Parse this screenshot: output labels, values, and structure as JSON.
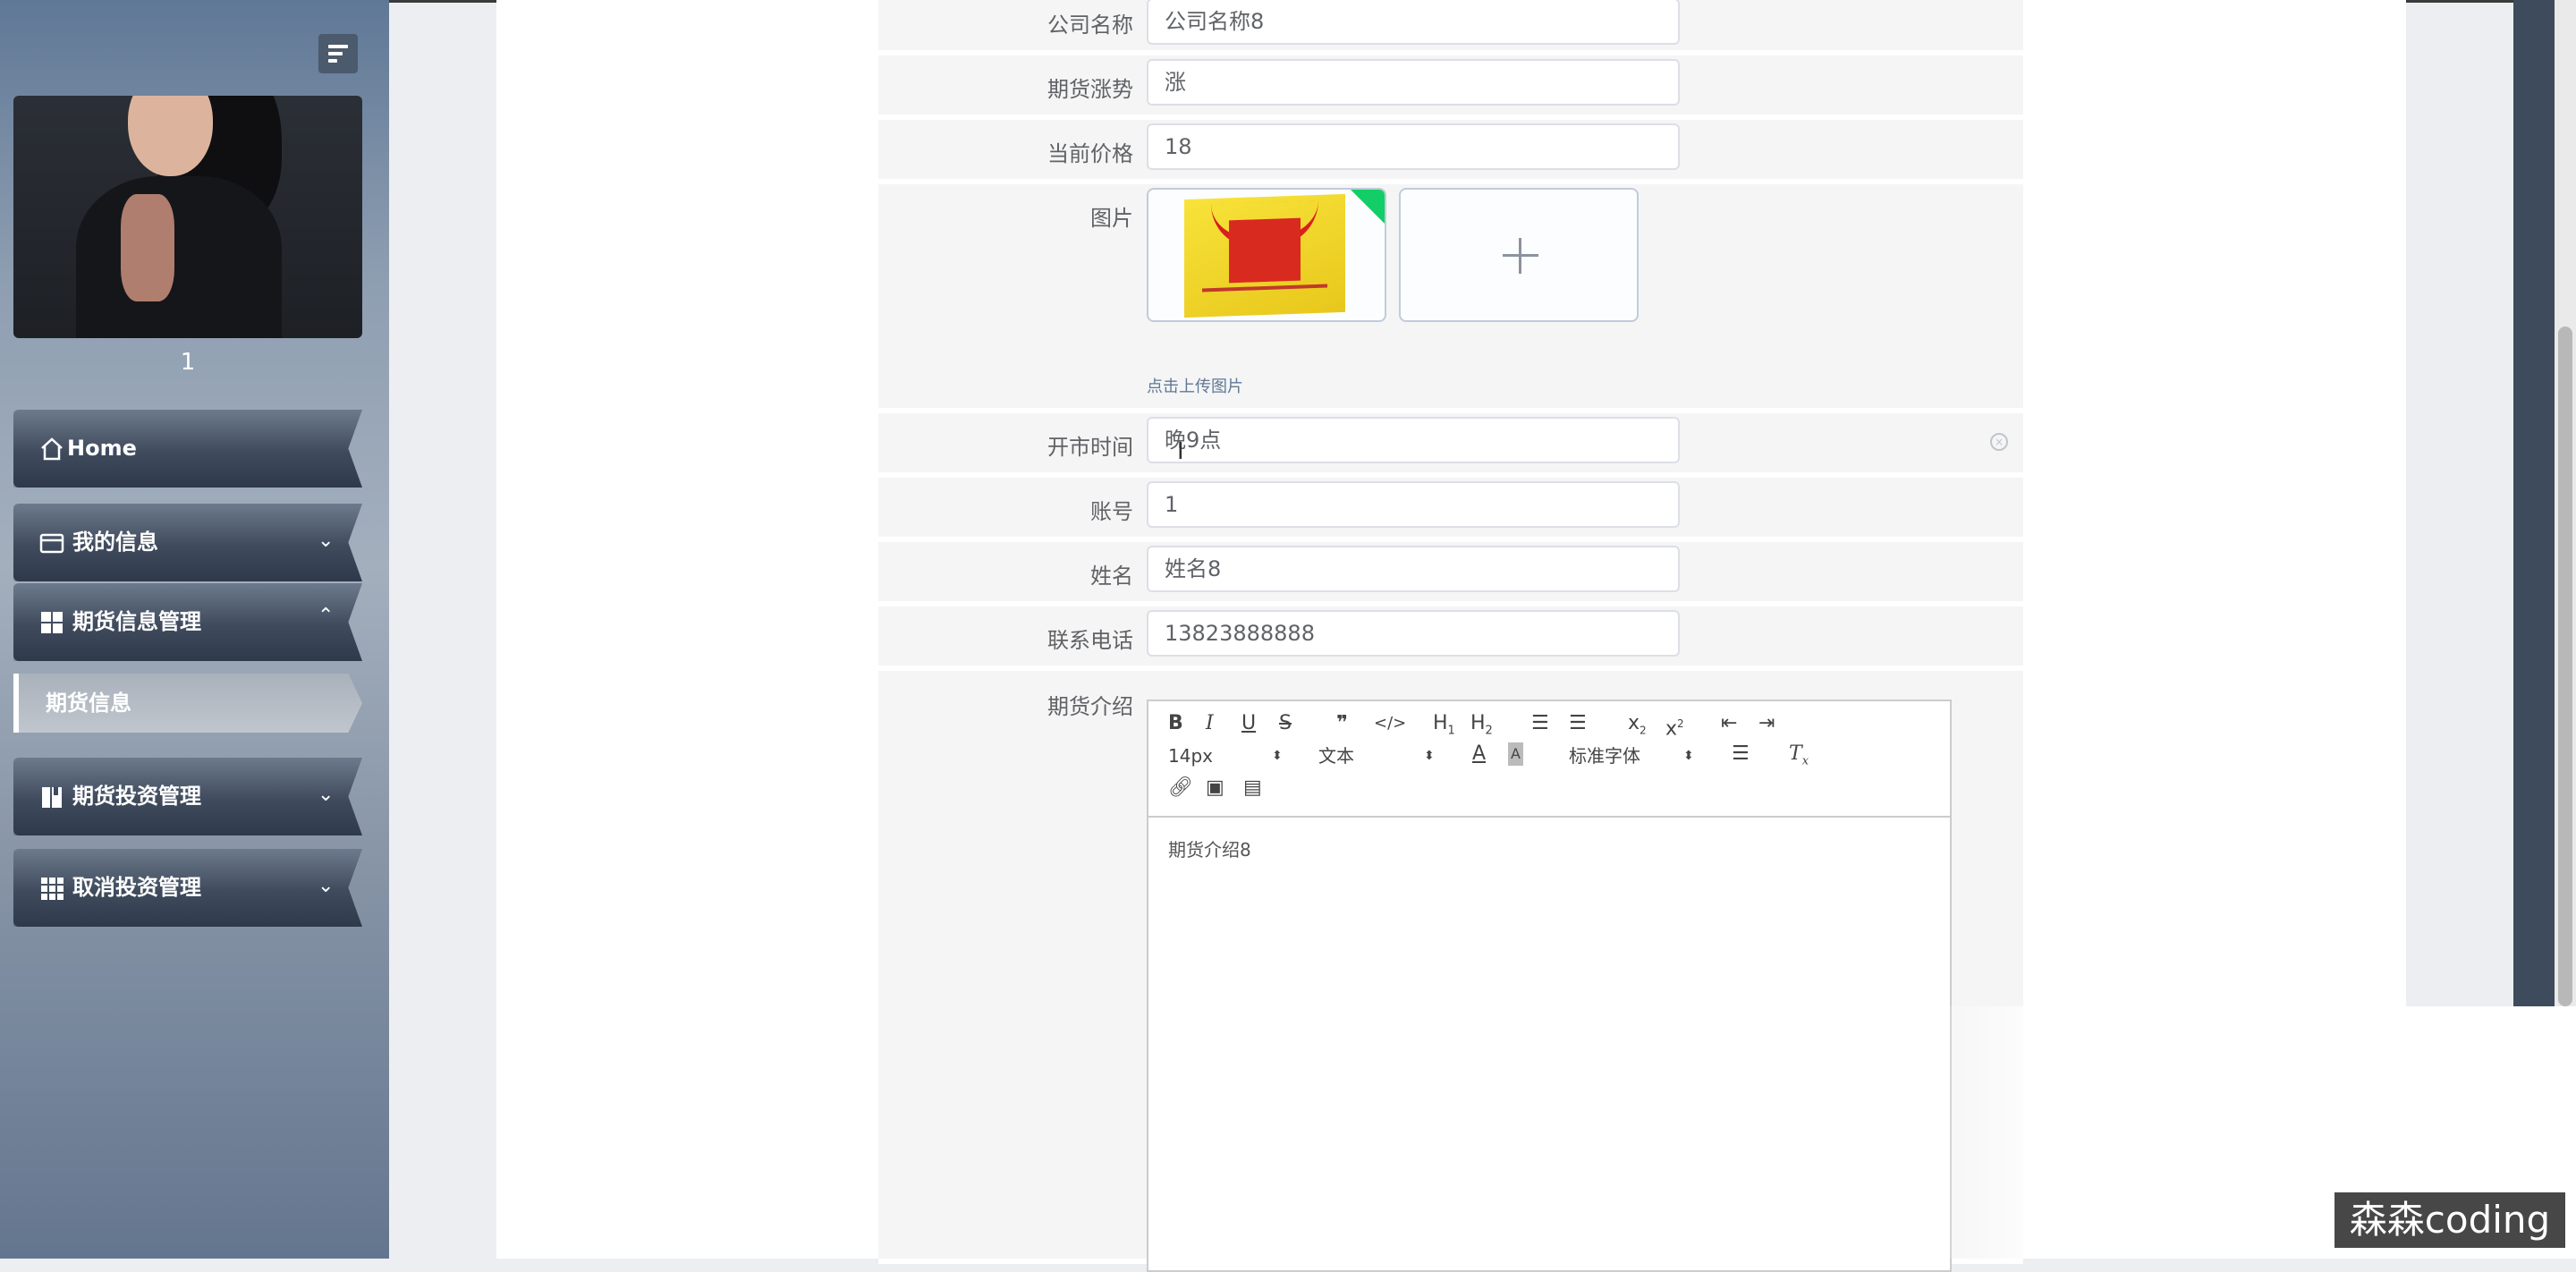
{
  "sidebar": {
    "username": "1",
    "items": [
      {
        "label": "Home",
        "icon": "home-icon"
      },
      {
        "label": "我的信息",
        "icon": "card-icon"
      },
      {
        "label": "期货信息管理",
        "icon": "grid-icon"
      },
      {
        "label": "期货投资管理",
        "icon": "book-icon"
      },
      {
        "label": "取消投资管理",
        "icon": "apps-icon"
      }
    ],
    "sub_item": {
      "label": "期货信息"
    }
  },
  "form": {
    "company_label": "公司名称",
    "company_value": "公司名称8",
    "trend_label": "期货涨势",
    "trend_value": "涨",
    "price_label": "当前价格",
    "price_value": "18",
    "image_label": "图片",
    "upload_hint": "点击上传图片",
    "open_time_label": "开市时间",
    "open_time_value": "晚9点",
    "account_label": "账号",
    "account_value": "1",
    "name_label": "姓名",
    "name_value": "姓名8",
    "phone_label": "联系电话",
    "phone_value": "13823888888",
    "intro_label": "期货介绍",
    "intro_value": "期货介绍8"
  },
  "editor": {
    "font_size": "14px",
    "block_type": "文本",
    "font_family": "标准字体"
  },
  "watermark": "森森coding",
  "colors": {
    "upload_badge": "#13ce66",
    "sidebar_dark": "#3f4b5d",
    "label": "#606266"
  }
}
